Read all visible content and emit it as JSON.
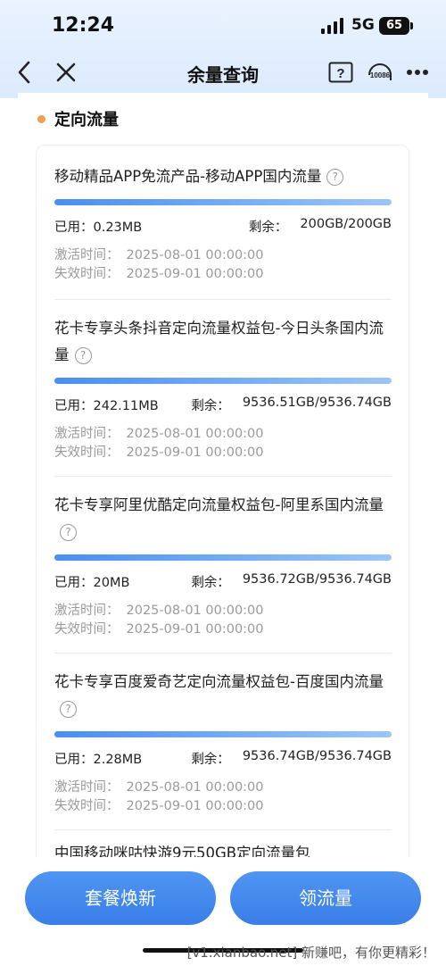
{
  "status_bar": {
    "time": "12:24",
    "network": "5G",
    "battery": "65",
    "icons": [
      "signal-icon",
      "battery-icon"
    ]
  },
  "nav": {
    "title": "余量查询",
    "service_number": "10086",
    "icons": [
      "back-icon",
      "close-icon",
      "help-icon",
      "customer-service-icon",
      "more-icon"
    ]
  },
  "section": {
    "title": "定向流量",
    "accent": "#f0a04a"
  },
  "packages": [
    {
      "name": "移动精品APP免流产品-移动APP国内流量",
      "used_label": "已用：",
      "used": "0.23MB",
      "remain_label": "剩余：",
      "remain": "200GB/200GB",
      "remain_fraction": 1.0,
      "activate_label": "激活时间：",
      "activate": "2025-08-01 00:00:00",
      "expire_label": "失效时间：",
      "expire": "2025-09-01 00:00:00"
    },
    {
      "name": "花卡专享头条抖音定向流量权益包-今日头条国内流量",
      "used_label": "已用：",
      "used": "242.11MB",
      "remain_label": "剩余：",
      "remain": "9536.51GB/9536.74GB",
      "remain_fraction": 1.0,
      "activate_label": "激活时间：",
      "activate": "2025-08-01 00:00:00",
      "expire_label": "失效时间：",
      "expire": "2025-09-01 00:00:00"
    },
    {
      "name": "花卡专享阿里优酷定向流量权益包-阿里系国内流量",
      "used_label": "已用：",
      "used": "20MB",
      "remain_label": "剩余：",
      "remain": "9536.72GB/9536.74GB",
      "remain_fraction": 1.0,
      "activate_label": "激活时间：",
      "activate": "2025-08-01 00:00:00",
      "expire_label": "失效时间：",
      "expire": "2025-09-01 00:00:00"
    },
    {
      "name": "花卡专享百度爱奇艺定向流量权益包-百度国内流量",
      "used_label": "已用：",
      "used": "2.28MB",
      "remain_label": "剩余：",
      "remain": "9536.74GB/9536.74GB",
      "remain_fraction": 1.0,
      "activate_label": "激活时间：",
      "activate": "2025-08-01 00:00:00",
      "expire_label": "失效时间：",
      "expire": "2025-09-01 00:00:00"
    },
    {
      "name": "中国移动咪咕快游9元50GB定向流量包"
    }
  ],
  "bottom": {
    "left_button": "套餐焕新",
    "right_button": "领流量",
    "accent": "#3a7ee8"
  },
  "watermark": "[v1.xianbao.net] 新赚吧，有你更精彩！"
}
